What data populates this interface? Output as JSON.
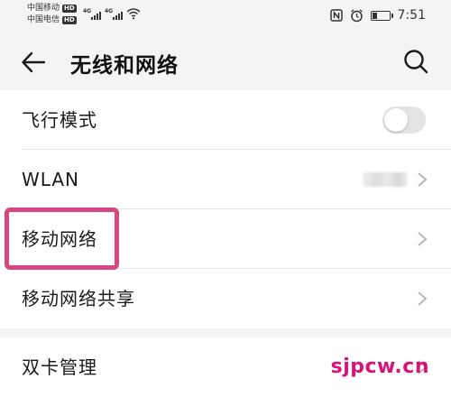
{
  "status_bar": {
    "carrier1": "中国移动",
    "carrier2": "中国电信",
    "hd_badge": "HD",
    "network_tag": "4G",
    "time": "7:51",
    "icons": [
      "nfc-icon",
      "alarm-icon",
      "battery-icon",
      "wifi-icon",
      "signal-icon"
    ]
  },
  "header": {
    "title": "无线和网络",
    "back_icon": "arrow-left-icon",
    "search_icon": "search-icon"
  },
  "items": [
    {
      "label": "飞行模式",
      "control": "toggle",
      "toggle_on": false
    },
    {
      "label": "WLAN",
      "control": "chevron",
      "value_blurred": true
    },
    {
      "label": "移动网络",
      "control": "chevron",
      "highlighted": true
    },
    {
      "label": "移动网络共享",
      "control": "chevron"
    },
    {
      "label": "双卡管理",
      "control": "chevron"
    }
  ],
  "highlight_color": "#d6487e",
  "watermark": "sjpcw.cn",
  "watermark_color": "#d8147a"
}
